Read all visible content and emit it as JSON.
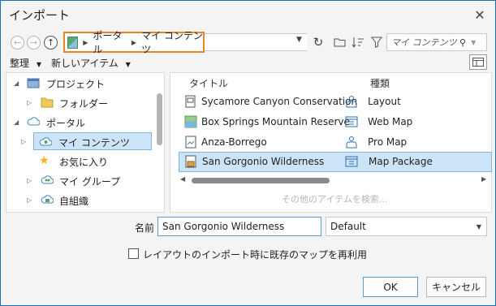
{
  "window": {
    "title": "インポート"
  },
  "address": {
    "crumbs": [
      "ポータル",
      "マイ コンテンツ"
    ]
  },
  "search": {
    "placeholder": "マイ コンテンツ の検索"
  },
  "menus": {
    "organize": "整理",
    "new_item": "新しいアイテム"
  },
  "tree": [
    {
      "label": "プロジェクト",
      "icon": "project-icon",
      "expanded": true
    },
    {
      "label": "フォルダー",
      "icon": "folder-icon"
    },
    {
      "label": "ポータル",
      "icon": "cloud-icon",
      "expanded": true
    },
    {
      "label": "マイ コンテンツ",
      "icon": "my-content-icon",
      "selected": true
    },
    {
      "label": "お気に入り",
      "icon": "favorites-star-icon"
    },
    {
      "label": "マイ グループ",
      "icon": "groups-icon"
    },
    {
      "label": "自組織",
      "icon": "organization-icon"
    }
  ],
  "columns": {
    "title": "タイトル",
    "type": "種類"
  },
  "items": [
    {
      "title": "Sycamore Canyon Conservation",
      "type": "Layout",
      "icon": "layout-icon",
      "type_icon": "layout-type-icon"
    },
    {
      "title": "Box Springs Mountain Reserve",
      "type": "Web Map",
      "icon": "web-map-icon",
      "type_icon": "web-map-type-icon"
    },
    {
      "title": "Anza-Borrego",
      "type": "Pro Map",
      "icon": "pro-map-icon",
      "type_icon": "pro-map-type-icon"
    },
    {
      "title": "San Gorgonio Wilderness",
      "type": "Map Package",
      "icon": "map-package-icon",
      "type_icon": "map-package-type-icon",
      "selected": true
    }
  ],
  "more_items": "その他のアイテムを検索...",
  "name_field": {
    "label": "名前",
    "value": "San Gorgonio Wilderness"
  },
  "filter_select": {
    "value": "Default"
  },
  "reuse_checkbox": {
    "label": "レイアウトのインポート時に既存のマップを再利用",
    "checked": false
  },
  "buttons": {
    "ok": "OK",
    "cancel": "キャンセル"
  },
  "colors": {
    "accent": "#e8852a",
    "selection": "#cce4f7",
    "selection_border": "#7db5e0"
  }
}
